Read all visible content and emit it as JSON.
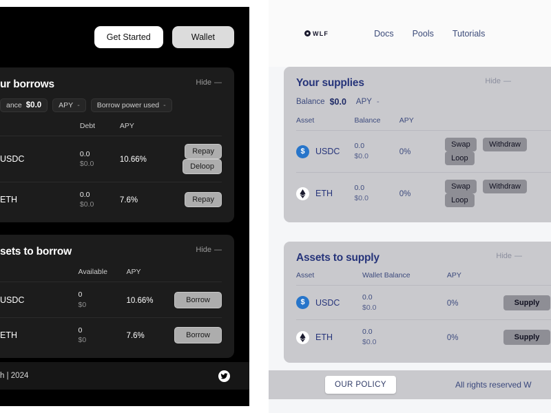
{
  "left_app": {
    "topbar": {
      "get_started_label": "Get Started",
      "wallet_label": "Wallet"
    },
    "borrows_card": {
      "title": "ur borrows",
      "hide_label": "Hide",
      "hide_dash": "—",
      "balance_label": "ance",
      "balance_value": "$0.0",
      "apy_label": "APY",
      "apy_value": "-",
      "borrow_power_label": "Borrow power used",
      "borrow_power_value": "-",
      "columns": [
        "",
        "Debt",
        "APY",
        ""
      ],
      "rows": [
        {
          "asset": "USDC",
          "debt_amount": "0.0",
          "debt_usd": "$0.0",
          "apy": "10.66%",
          "actions": [
            "Repay",
            "Deloop"
          ]
        },
        {
          "asset": "ETH",
          "debt_amount": "0.0",
          "debt_usd": "$0.0",
          "apy": "7.6%",
          "actions": [
            "Repay"
          ]
        }
      ]
    },
    "assets_to_borrow_card": {
      "title": "sets to borrow",
      "hide_label": "Hide",
      "hide_dash": "—",
      "columns": [
        "",
        "Available",
        "APY",
        ""
      ],
      "rows": [
        {
          "asset": "USDC",
          "available_amount": "0",
          "available_usd": "$0",
          "apy": "10.66%",
          "actions": [
            "Borrow"
          ]
        },
        {
          "asset": "ETH",
          "available_amount": "0",
          "available_usd": "$0",
          "apy": "7.6%",
          "actions": [
            "Borrow"
          ]
        }
      ]
    },
    "footer": {
      "copyright": "h | 2024",
      "social_icon": "twitter-icon"
    }
  },
  "right_app": {
    "nav": {
      "logo_text": "WLF",
      "logo_icon": "wlf-logo-icon",
      "links": [
        "Docs",
        "Pools",
        "Tutorials"
      ]
    },
    "supplies_card": {
      "title": "Your supplies",
      "hide_label": "Hide",
      "hide_dash": "—",
      "balance_label": "Balance",
      "balance_value": "$0.0",
      "apy_label": "APY",
      "apy_value": "-",
      "columns": [
        "Asset",
        "Balance",
        "APY",
        ""
      ],
      "rows": [
        {
          "asset": "USDC",
          "balance_amount": "0.0",
          "balance_usd": "$0.0",
          "apy": "0%",
          "actions": [
            "Swap",
            "Withdraw",
            "Loop"
          ]
        },
        {
          "asset": "ETH",
          "balance_amount": "0.0",
          "balance_usd": "$0.0",
          "apy": "0%",
          "actions": [
            "Swap",
            "Withdraw",
            "Loop"
          ]
        }
      ]
    },
    "assets_to_supply_card": {
      "title": "Assets to supply",
      "hide_label": "Hide",
      "hide_dash": "—",
      "columns": [
        "Asset",
        "Wallet Balance",
        "APY",
        ""
      ],
      "rows": [
        {
          "asset": "USDC",
          "wallet_amount": "0.0",
          "wallet_usd": "$0.0",
          "apy": "0%",
          "actions": [
            "Supply"
          ]
        },
        {
          "asset": "ETH",
          "wallet_amount": "0.0",
          "wallet_usd": "$0.0",
          "apy": "0%",
          "actions": [
            "Supply"
          ]
        }
      ]
    },
    "footer": {
      "policy_label": "OUR POLICY",
      "rights_label": "All rights reserved W"
    }
  },
  "colors": {
    "dark_bg": "#000000",
    "dark_card": "#1c1c1c",
    "light_bg": "#f5f6f8",
    "light_card": "#c9c9cd",
    "accent_navy": "#26347a",
    "usdc_blue": "#2775ca",
    "button_grey": "#8e8e95"
  }
}
